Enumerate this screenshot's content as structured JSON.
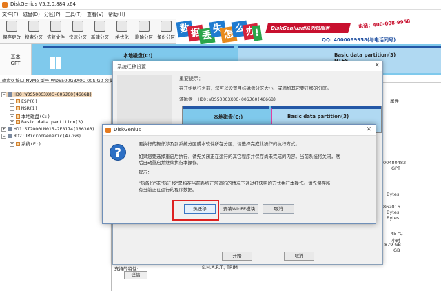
{
  "app": {
    "title": "DiskGenius V5.2.0.884 x64"
  },
  "menu": [
    "文件(F)",
    "磁盘(D)",
    "分区(P)",
    "工具(T)",
    "查看(V)",
    "帮助(H)"
  ],
  "toolbar": [
    {
      "label": "保存更改",
      "icon": "save-icon"
    },
    {
      "label": "搜索分区",
      "icon": "search-partition-icon"
    },
    {
      "label": "恢复文件",
      "icon": "recover-files-icon"
    },
    {
      "label": "快速分区",
      "icon": "quick-partition-icon"
    },
    {
      "label": "新建分区",
      "icon": "new-partition-icon"
    },
    {
      "label": "格式化",
      "icon": "format-icon"
    },
    {
      "label": "删除分区",
      "icon": "delete-partition-icon"
    },
    {
      "label": "备份分区",
      "icon": "backup-partition-icon"
    }
  ],
  "banner": {
    "chars": [
      "数",
      "据",
      "丢",
      "失",
      "怎",
      "么",
      "办",
      "!"
    ],
    "slogan": "DiskGenius团队为您服务",
    "phone": "电话：400-008-9958",
    "qq": "QQ: 4000089958(与电话同号)"
  },
  "disk": {
    "type": "基本",
    "style": "GPT",
    "partition_c_label": "本地磁盘(C:)",
    "partition_b_label": "Basic data partition(3)",
    "partition_b_sub": "NTFS",
    "info_line": "磁盘0 接口:NVMe 型号:WDS500G3X0C-00SJG0 容量:465.8GB(476940MB) 柱面数:60801 磁头数:255 每道扇区数:63 总扇区数:976773168"
  },
  "tree": [
    {
      "text": "HD0:WDS500G3X0C-00SJG0(466GB)",
      "kind": "disk",
      "selected": true
    },
    {
      "text": "ESP(0)",
      "kind": "part"
    },
    {
      "text": "MSR(1)",
      "kind": "part"
    },
    {
      "text": "本地磁盘(C:)",
      "kind": "part"
    },
    {
      "text": "Basic data partition(3)",
      "kind": "part"
    },
    {
      "text": "HD1:ST2000LM015-2E8174(1863GB)",
      "kind": "disk"
    },
    {
      "text": "RD2:JMicronGeneric(477GB)",
      "kind": "disk"
    },
    {
      "text": "系统(E:)",
      "kind": "part"
    }
  ],
  "right_panel": {
    "col_attr": "属性",
    "v1": "00480482",
    "v2": "GPT",
    "v3": "Bytes",
    "v4": "862016",
    "v5": "Bytes",
    "v6": "Bytes",
    "v7": "45 ℃",
    "v8": "小时",
    "v9": "879 GB",
    "v10": "GB",
    "support_label": "支持的特性:",
    "support_value": "S.M.A.R.T., TRIM",
    "detail_button": "详情"
  },
  "migration": {
    "title": "系统迁移设置",
    "tip_title": "重要提示：",
    "tip_text": "在开始执行之前，您可以设置目标磁盘分区大小、或添加其它要迁移的分区。",
    "source_disk": "源磁盘:  HD0:WDS500G3X0C-00SJG0(466GB)",
    "c_label": "本地磁盘(C:)",
    "b_label": "Basic data partition(3)",
    "start_button": "开始",
    "cancel_button": "取消"
  },
  "dialog": {
    "title": "DiskGenius",
    "line1": "要执行的操作涉及到系统分区或本软件所在分区，请选择完成此操作的执行方式。",
    "line2": "如果您要选择重启后执行，请先关闭正在运行的其它程序并保存尚未完成的内容。当前系统将关闭，然",
    "line3": "后自动重启并继续执行本操作。",
    "line4": "提示：",
    "line5": "\"热备份\"或\"热迁移\"是指在当前系统正常运行的情况下通过打快照的方式执行本操作。请先保存所",
    "line6": "有当前正在运行的程序数据。",
    "btn_hot": "热迁移",
    "btn_winpe": "安装WinPE模块",
    "btn_cancel": "取消"
  }
}
